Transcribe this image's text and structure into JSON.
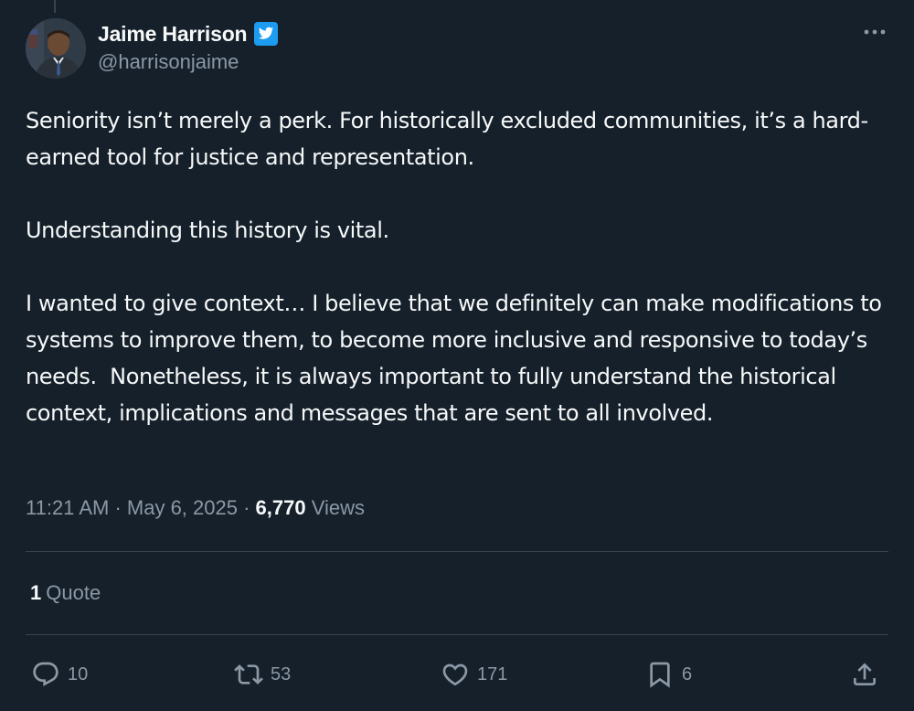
{
  "author": {
    "display_name": "Jaime Harrison",
    "handle": "@harrisonjaime",
    "verified": true
  },
  "tweet": {
    "paragraphs": [
      "Seniority isn’t merely a perk. For historically excluded communities, it’s a hard-earned tool for justice and representation.",
      "Understanding this history is vital.",
      "I wanted to give context… I believe that we definitely can make modifications to systems to improve them, to become more inclusive and responsive to today’s needs.  Nonetheless, it is always important to fully understand the historical context, implications and messages that are sent to all involved."
    ]
  },
  "meta": {
    "time": "11:21 AM",
    "separator": " · ",
    "date": "May 6, 2025",
    "views_count": "6,770",
    "views_label": " Views"
  },
  "quotes": {
    "count": "1",
    "label": "Quote"
  },
  "actions": {
    "reply": {
      "icon": "reply-icon",
      "count": "10"
    },
    "retweet": {
      "icon": "retweet-icon",
      "count": "53"
    },
    "like": {
      "icon": "heart-icon",
      "count": "171"
    },
    "bookmark": {
      "icon": "bookmark-icon",
      "count": "6"
    },
    "share": {
      "icon": "share-icon"
    }
  },
  "colors": {
    "background": "#15202b",
    "text_primary": "#f7f9f9",
    "text_secondary": "#8b98a5",
    "divider": "#38444d",
    "verified_badge": "#1d9bf0"
  }
}
